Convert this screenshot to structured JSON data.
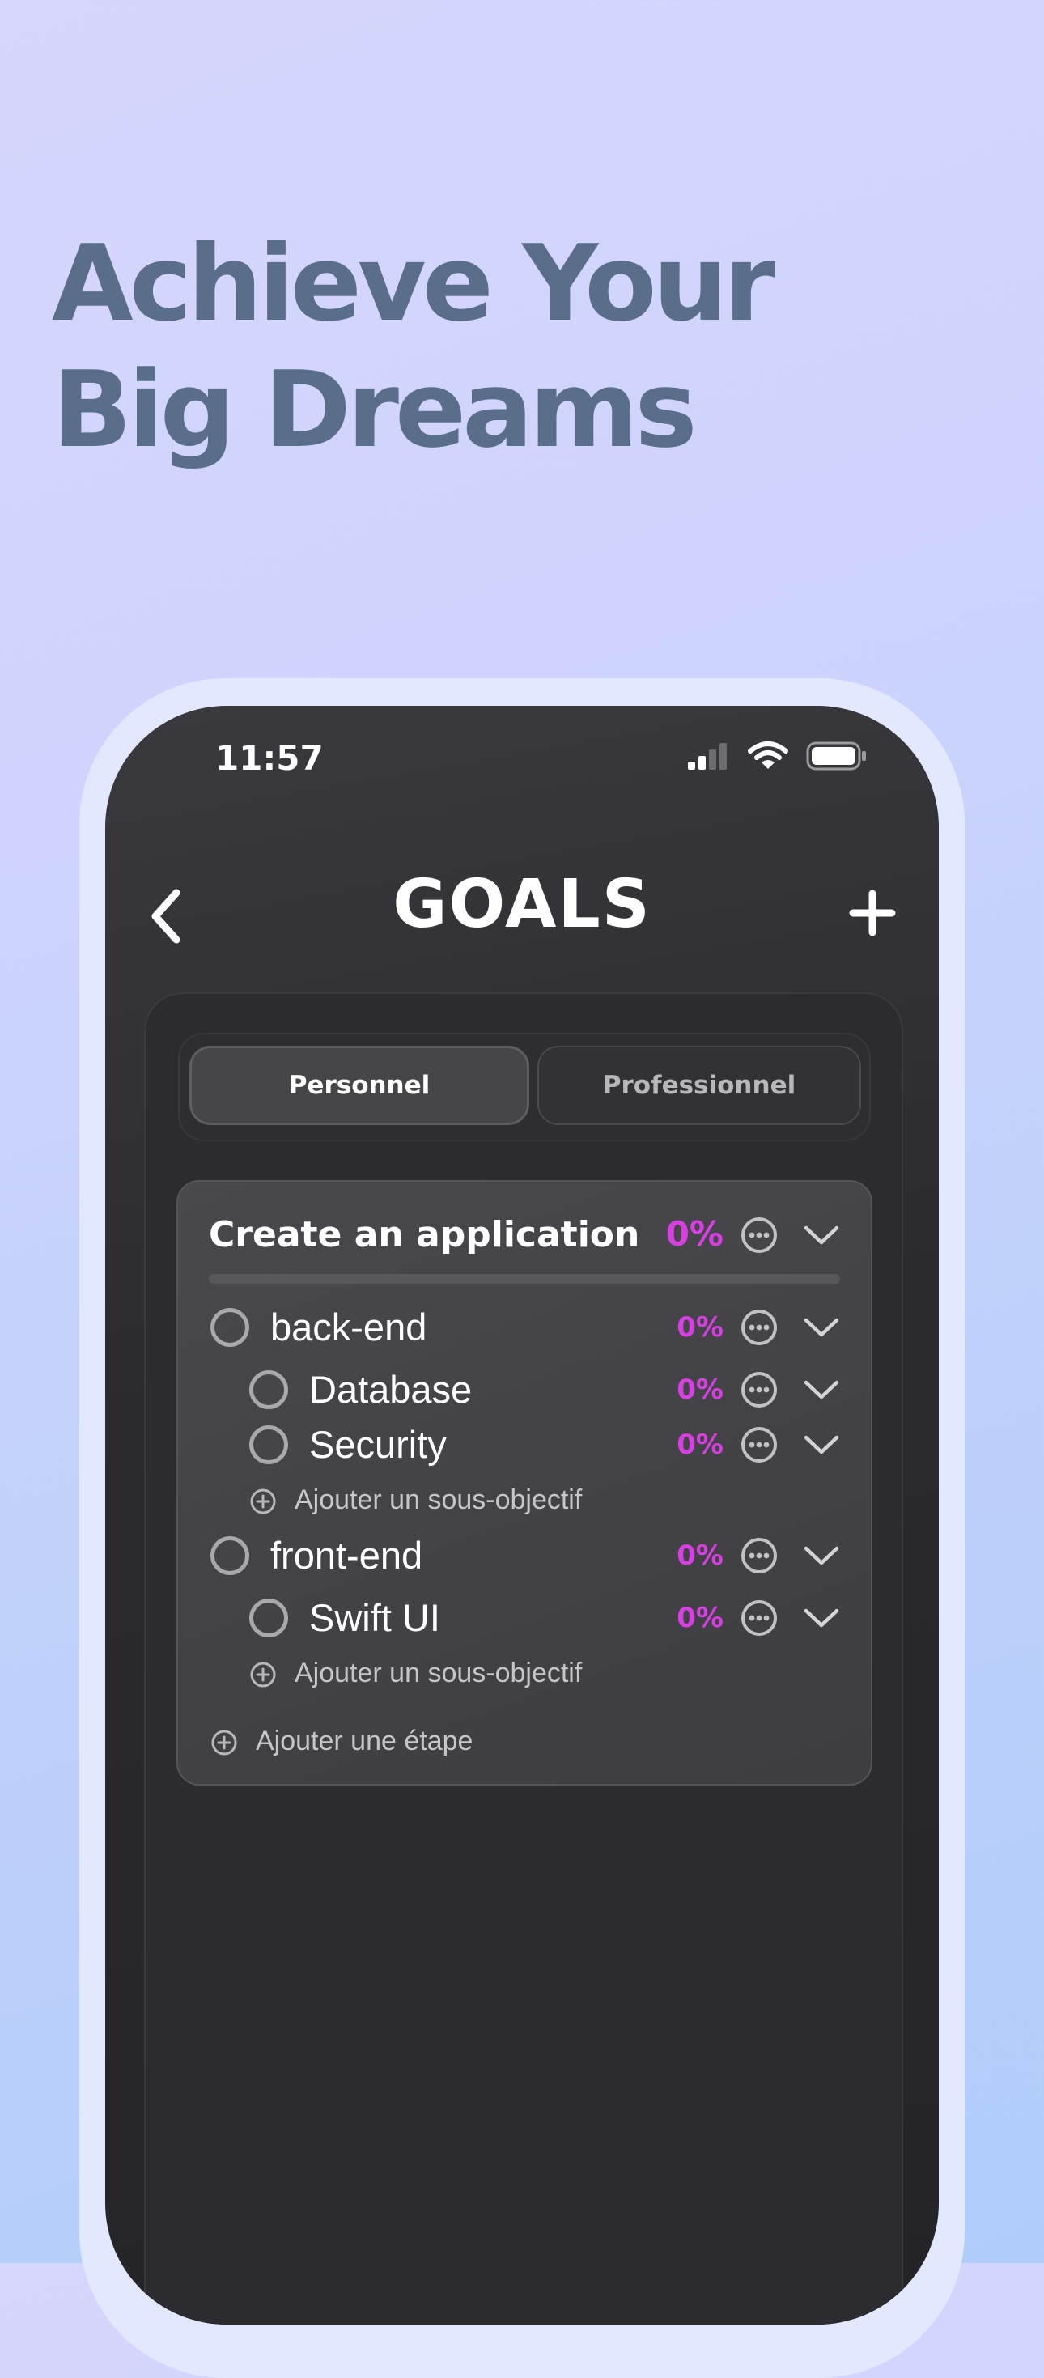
{
  "headline": {
    "line1": "Achieve Your",
    "line2": "Big Dreams"
  },
  "status_bar": {
    "time": "11:57"
  },
  "nav": {
    "title": "GOALS"
  },
  "segments": {
    "personal": "Personnel",
    "professional": "Professionnel",
    "selected": "Personnel"
  },
  "goal": {
    "title": "Create an application",
    "percent": "0%",
    "progress": 0,
    "steps": [
      {
        "label": "back-end",
        "percent": "0%",
        "subgoals": [
          {
            "label": "Database",
            "percent": "0%"
          },
          {
            "label": "Security",
            "percent": "0%"
          }
        ],
        "add_subgoal_label": "Ajouter un sous-objectif"
      },
      {
        "label": "front-end",
        "percent": "0%",
        "subgoals": [
          {
            "label": "Swift UI",
            "percent": "0%"
          }
        ],
        "add_subgoal_label": "Ajouter un sous-objectif"
      }
    ],
    "add_step_label": "Ajouter une étape"
  },
  "colors": {
    "accent": "#d63fe0",
    "headline": "#5a6e8c",
    "screen_bg": "#2b2b2f",
    "card_bg": "#45454a"
  },
  "icons": [
    "signal-icon",
    "wifi-icon",
    "battery-icon",
    "back-chevron-icon",
    "plus-icon",
    "more-circle-icon",
    "chevron-down-icon",
    "circle-checkbox-icon",
    "plus-circle-icon"
  ]
}
